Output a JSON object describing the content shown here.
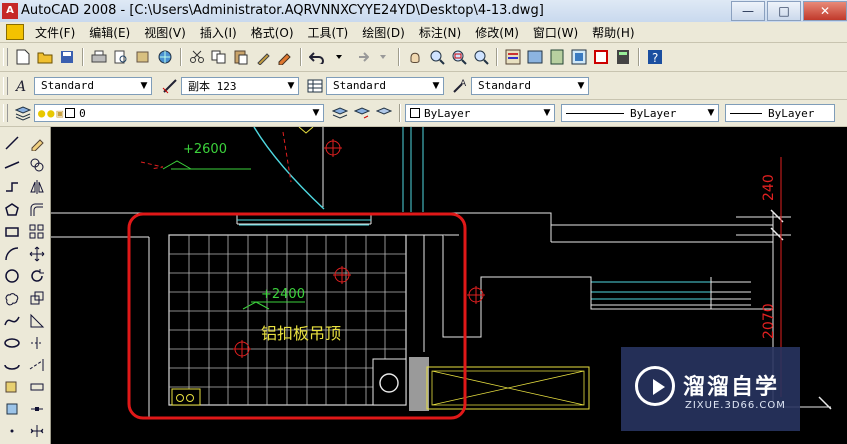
{
  "window": {
    "app_icon_letter": "A",
    "title": "AutoCAD 2008 - [C:\\Users\\Administrator.AQRVNNXCYYE24YD\\Desktop\\4-13.dwg]",
    "minimize": "—",
    "maximize": "□",
    "close": "✕"
  },
  "menu": [
    "文件(F)",
    "编辑(E)",
    "视图(V)",
    "插入(I)",
    "格式(O)",
    "工具(T)",
    "绘图(D)",
    "标注(N)",
    "修改(M)",
    "窗口(W)",
    "帮助(H)"
  ],
  "styles_toolbar": {
    "text_style": "Standard",
    "dim_style": "副本 123",
    "table_style": "Standard",
    "multileader_style": "Standard"
  },
  "layers_toolbar": {
    "current_layer": "0",
    "color": "ByLayer",
    "linetype": "ByLayer",
    "lineweight": "ByLayer"
  },
  "drawing": {
    "label_elev_top": "+2600",
    "label_elev_room": "+2400",
    "label_ceiling": "铝扣板吊顶",
    "dim_top": "240",
    "dim_right": "2070"
  },
  "watermark": {
    "title": "溜溜自学",
    "subtitle": "ZIXUE.3D66.COM"
  },
  "colors": {
    "toolbar_bg": "#ece9d8",
    "canvas_bg": "#000000",
    "cyan": "#4fd8e0",
    "white": "#e8e8e8",
    "red": "#e02020",
    "green": "#3cd23c",
    "yellow": "#e8e040",
    "highlight": "#e01818"
  }
}
